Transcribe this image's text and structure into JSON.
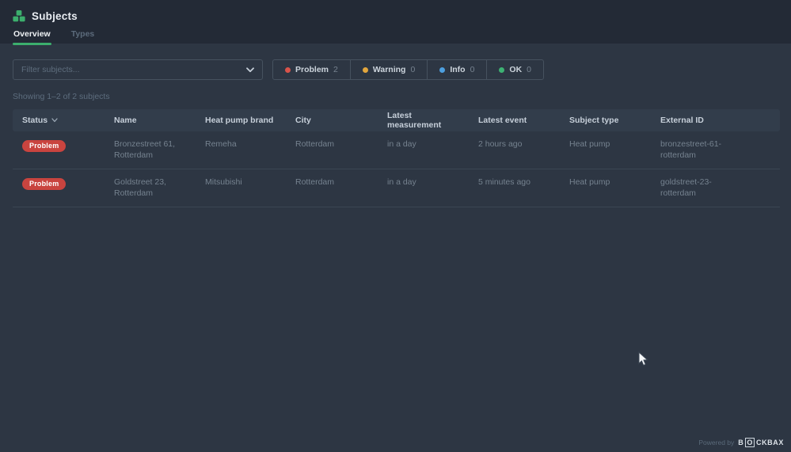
{
  "theme": {
    "background": "#2d3643",
    "topbar_background": "#232a36",
    "accent_green": "#3cae6d",
    "problem_red": "#c9443f",
    "table_header_background": "#323d4b"
  },
  "app": {
    "title": "Subjects"
  },
  "tabs": [
    {
      "label": "Overview",
      "active": true
    },
    {
      "label": "Types",
      "active": false
    }
  ],
  "filter": {
    "placeholder": "Filter subjects..."
  },
  "status_filters": [
    {
      "label": "Problem",
      "count": "2",
      "color": "#d9534a"
    },
    {
      "label": "Warning",
      "count": "0",
      "color": "#e2a63d"
    },
    {
      "label": "Info",
      "count": "0",
      "color": "#4d9fdf"
    },
    {
      "label": "OK",
      "count": "0",
      "color": "#3db273"
    }
  ],
  "summary": "Showing 1–2 of 2 subjects",
  "table": {
    "columns": [
      "Status",
      "Name",
      "Heat pump brand",
      "City",
      "Latest measurement",
      "Latest event",
      "Subject type",
      "External ID"
    ],
    "rows": [
      {
        "status": "Problem",
        "name": "Bronzestreet 61, Rotterdam",
        "brand": "Remeha",
        "city": "Rotterdam",
        "latest_measurement": "in a day",
        "latest_event": "2 hours ago",
        "subject_type": "Heat pump",
        "external_id": "bronzestreet-61-rotterdam"
      },
      {
        "status": "Problem",
        "name": "Goldstreet 23, Rotterdam",
        "brand": "Mitsubishi",
        "city": "Rotterdam",
        "latest_measurement": "in a day",
        "latest_event": "5 minutes ago",
        "subject_type": "Heat pump",
        "external_id": "goldstreet-23-rotterdam"
      }
    ]
  },
  "footer": {
    "powered_by": "Powered by",
    "brand_first": "B",
    "brand_boxed": "O",
    "brand_rest": "CKBAX"
  },
  "icons": {
    "subjects-icon": "green-blocks",
    "chevron-down-icon": "v",
    "sort-chevron-icon": "v",
    "mouse-cursor": "arrow"
  }
}
